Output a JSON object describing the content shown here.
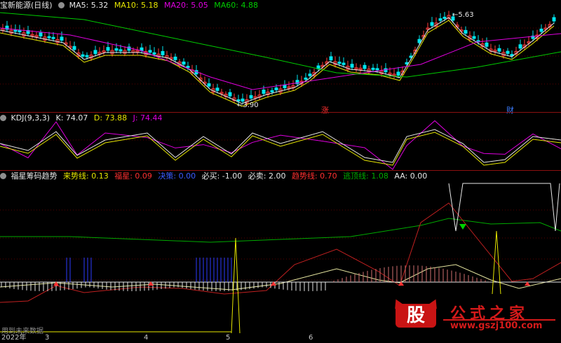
{
  "main_pane": {
    "stock_name": "宝新能源(日线)",
    "ma_items": [
      {
        "label": "MA5: 5.32",
        "color": "#e8e8e8"
      },
      {
        "label": "MA10: 5.18",
        "color": "#e6e600"
      },
      {
        "label": "MA20: 5.05",
        "color": "#e000e0"
      },
      {
        "label": "MA60: 4.88",
        "color": "#00cc00"
      }
    ],
    "high_label": "5.63",
    "low_label": "3.90",
    "markers": [
      {
        "text": "涨",
        "color": "#ff3030"
      },
      {
        "text": "财",
        "color": "#3a7cff"
      }
    ]
  },
  "kdj_pane": {
    "title": "KDJ(9,3,3)",
    "items": [
      {
        "label": "K: 74.07",
        "color": "#e8e8e8"
      },
      {
        "label": "D: 73.88",
        "color": "#e6e600"
      },
      {
        "label": "J: 74.44",
        "color": "#e000e0"
      }
    ]
  },
  "indicator_pane": {
    "title": "福星筹码趋势",
    "items": [
      {
        "label": "来势线: 0.13",
        "color": "#e6e600"
      },
      {
        "label": "福星: 0.09",
        "color": "#ff3030"
      },
      {
        "label": "决策: 0.00",
        "color": "#3a5cff"
      },
      {
        "label": "必买: -1.00",
        "color": "#e8e8e8"
      },
      {
        "label": "必卖: 2.00",
        "color": "#e8e8e8"
      },
      {
        "label": "趋势线: 0.70",
        "color": "#ff3030"
      },
      {
        "label": "逃顶线: 1.08",
        "color": "#00aa00"
      },
      {
        "label": "AA: 0.00",
        "color": "#e8e8e8"
      }
    ],
    "footer_note": "用到未来数据"
  },
  "axis": {
    "labels": [
      "2022年",
      "3",
      "4",
      "5",
      "6"
    ]
  },
  "watermark": {
    "logo": "股",
    "title": "公式之家",
    "url": "www.gszj100.com"
  },
  "colors": {
    "up": "#ff3a3a",
    "down": "#00e5ee",
    "border": "#8a1010"
  }
}
